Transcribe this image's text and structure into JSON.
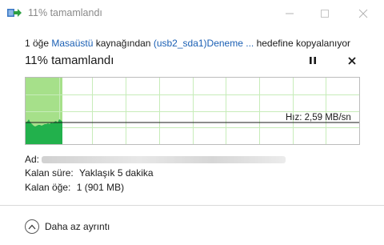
{
  "window": {
    "title": "11% tamamlandı"
  },
  "status": {
    "count": "1 öğe",
    "source": "Masaüstü",
    "mid": "kaynağından",
    "destination": "(usb2_sda1)Deneme ...",
    "suffix": "hedefine kopyalanıyor"
  },
  "progress": {
    "heading": "11% tamamlandı",
    "fraction": 0.11,
    "speed_label": "Hız: 2,59 MB/sn"
  },
  "details": {
    "name_key": "Ad:",
    "time_key": "Kalan süre:",
    "time_value": "Yaklaşık 5 dakika",
    "items_key": "Kalan öğe:",
    "items_value": "1 (901 MB)"
  },
  "footer": {
    "toggle_label": "Daha az ayrıntı"
  },
  "colors": {
    "progress_fill": "#a6e08a",
    "speed_area": "#22b14c",
    "grid": "#c7ecb9",
    "link": "#1a5fb4"
  },
  "icons": {
    "app": "copy-arrow-icon",
    "pause": "pause-icon",
    "cancel": "close-icon",
    "toggle": "chevron-up-circle-icon"
  }
}
